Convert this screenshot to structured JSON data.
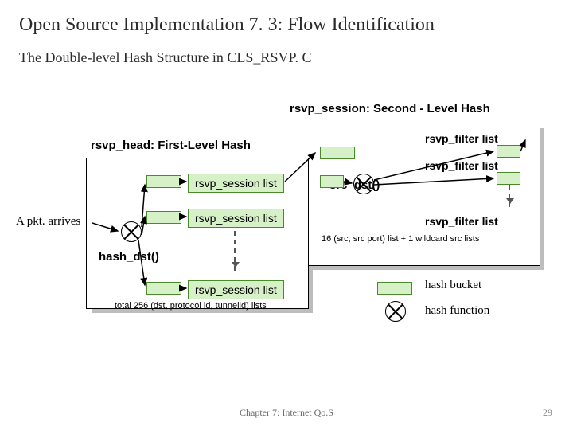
{
  "title": "Open Source Implementation 7. 3: Flow Identification",
  "subtitle": "The Double-level Hash Structure in CLS_RSVP. C",
  "labels": {
    "second_level": "rsvp_session: Second - Level Hash",
    "first_level": "rsvp_head: First-Level Hash",
    "session_list_1": "rsvp_session list",
    "session_list_2": "rsvp_session list",
    "session_list_3": "rsvp_session list",
    "filter_list_1": "rsvp_filter list",
    "filter_list_2": "rsvp_filter list",
    "filter_list_3": "rsvp_filter list",
    "pkt_arrives": "A pkt. arrives",
    "hash_dst": "hash_dst()",
    "src_dst": "src_dst()",
    "total_256": "total 256 (dst, protocol id, tunnelid) lists",
    "sixteen_src": "16 (src, src port) list + 1 wildcard src lists",
    "legend_bucket": "hash bucket",
    "legend_fn": "hash function"
  },
  "footer": "Chapter 7: Internet Qo.S",
  "page": "29"
}
